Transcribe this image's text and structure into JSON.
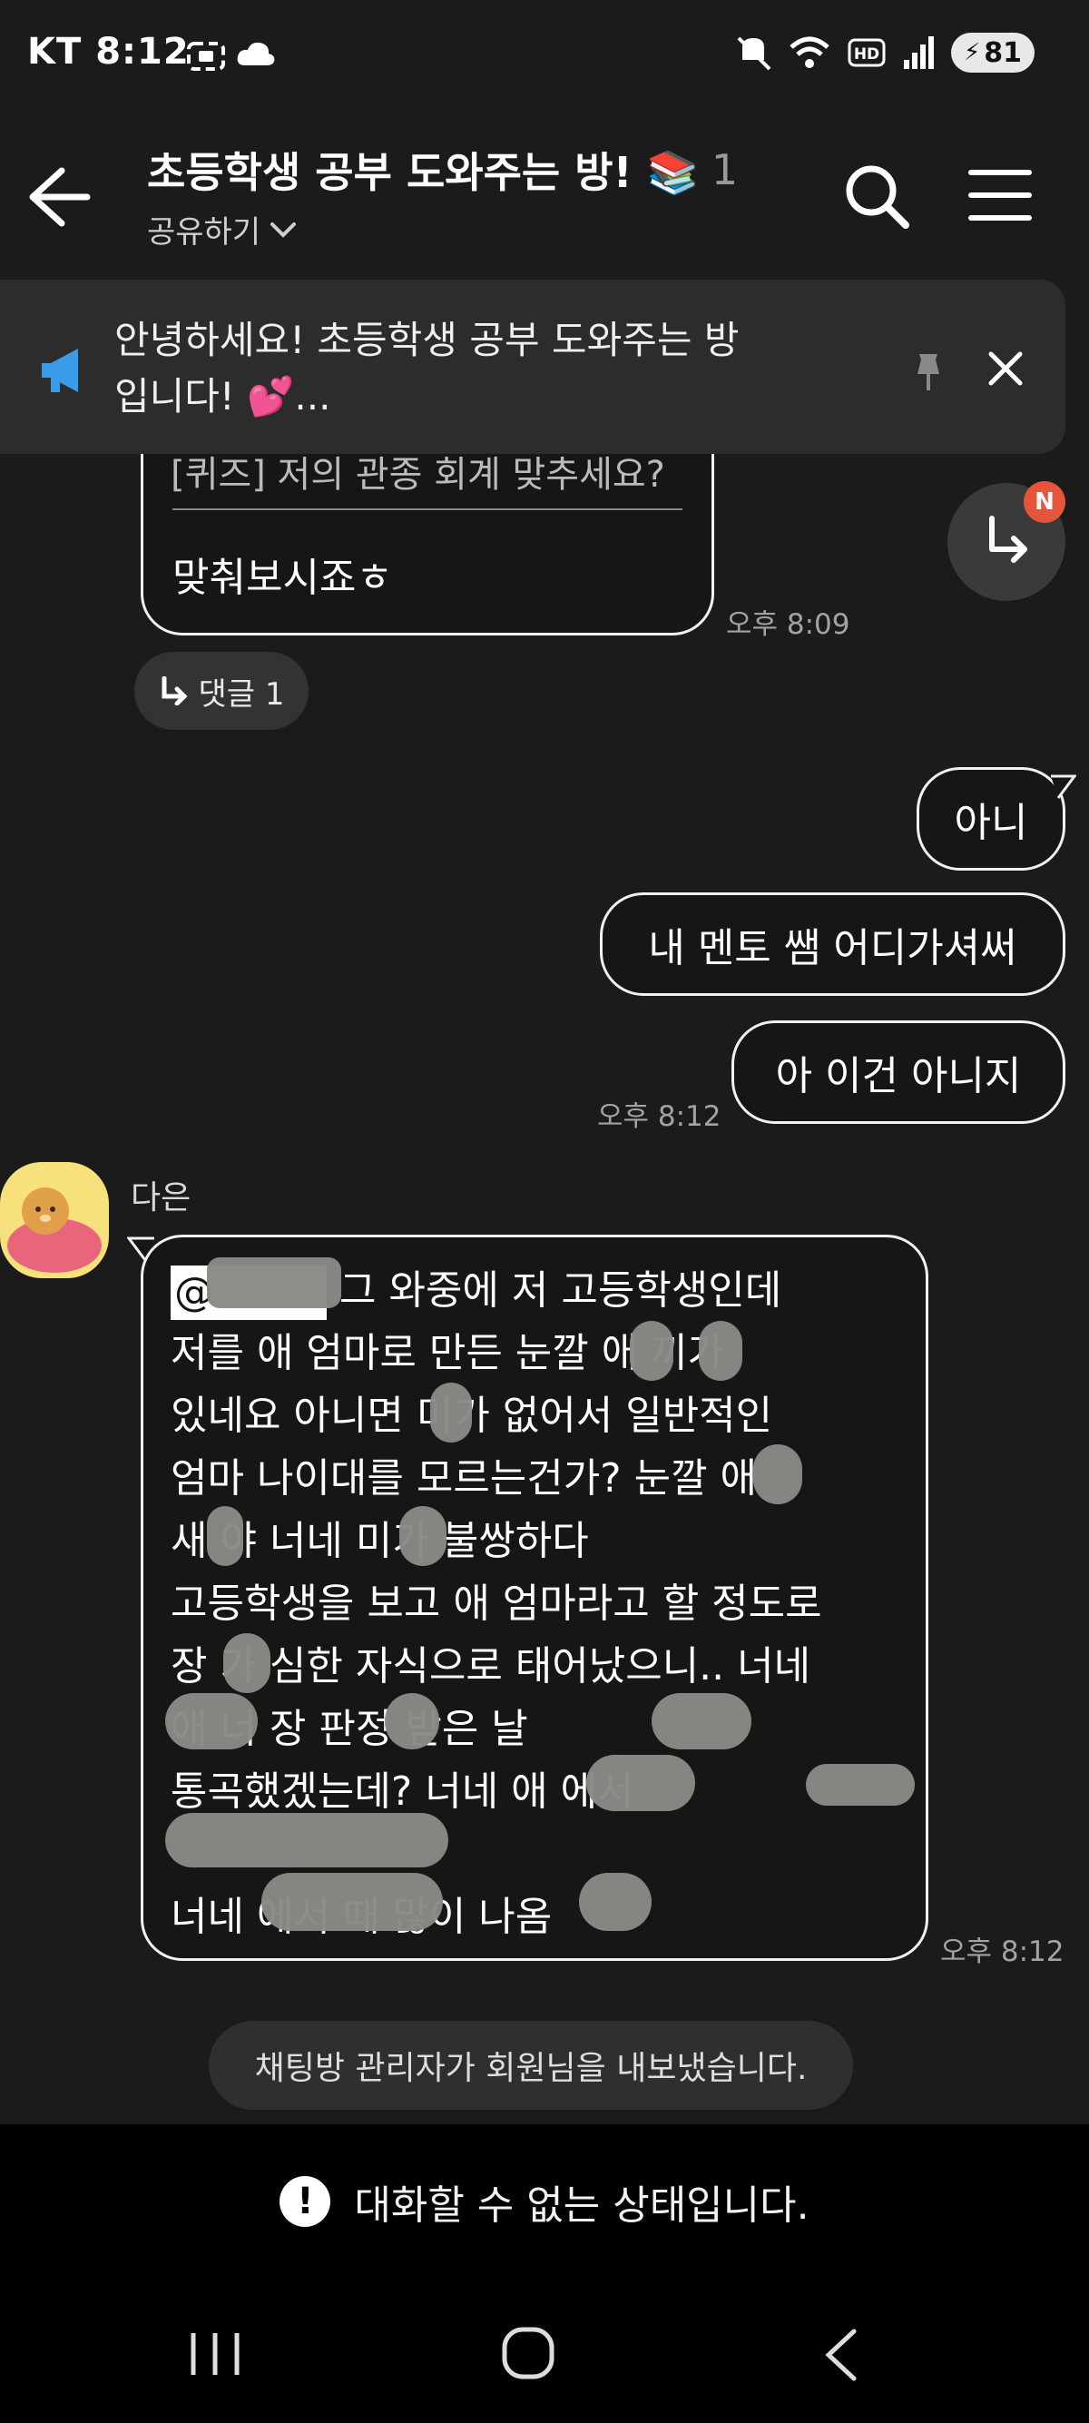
{
  "status_bar": {
    "carrier": "KT",
    "time": "8:12",
    "battery": "81",
    "icons": [
      "screenshot-icon",
      "cloud-icon",
      "mute-icon",
      "wifi-icon",
      "hd-icon",
      "signal-icon",
      "battery-icon"
    ]
  },
  "header": {
    "title": "초등학생 공부 도와주는 방! 📚",
    "member_count": "1",
    "share_label": "공유하기"
  },
  "notice": {
    "text": "안녕하세요! 초등학생 공부 도와주는 방입니다! 💕..."
  },
  "messages": {
    "first": {
      "cut_text": "[퀴즈] 저의 관종 회계 맞추세요?",
      "text": "맞춰보시죠ㅎ",
      "time": "오후 8:09",
      "reply_label": "댓글 1"
    },
    "jump_badge": "N",
    "mine": [
      {
        "text": "아니"
      },
      {
        "text": "내 멘토 쌤 어디가셔써"
      },
      {
        "text": "아 이건 아니지"
      }
    ],
    "mine_time": "오후 8:12",
    "other": {
      "sender": "다은",
      "time": "오후 8:12",
      "mention": "@",
      "lines": [
        "그 와중에 저 고등학생인데",
        "저를 애 엄마로 만든 눈깔  애  끼가",
        "있네요 아니면  미가 없어서 일반적인",
        "엄마 나이대를 모르는건가? 눈깔  애",
        "새  야 너네   미가 불쌍하다",
        "고등학생을 보고 애 엄마라고 할 정도로",
        "장  가 심한 자식으로 태어났으니.. 너네",
        "애   너 장   판정 받은 날  ",
        "통곡했겠는데? 너네 애      에서",
        "",
        "너네          에서 때     많이 나옴"
      ]
    }
  },
  "system_message": "채팅방 관리자가 회원님을 내보냈습니다.",
  "input_disabled": "대화할 수 없는 상태입니다."
}
